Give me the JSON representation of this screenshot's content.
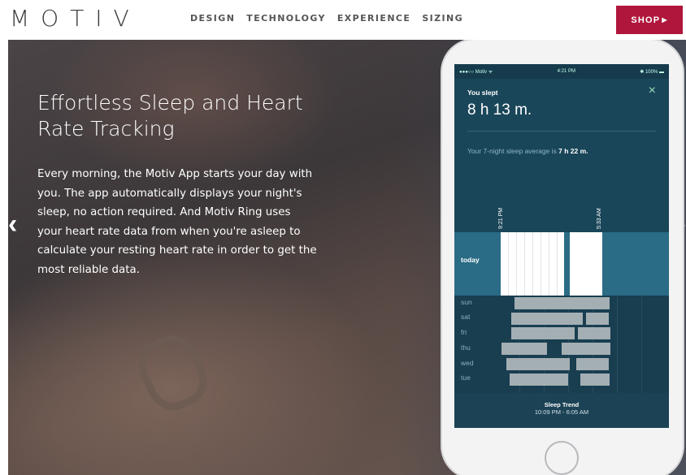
{
  "brand": {
    "logo": "MOTIV"
  },
  "nav": {
    "items": [
      {
        "label": "DESIGN"
      },
      {
        "label": "TECHNOLOGY"
      },
      {
        "label": "EXPERIENCE"
      },
      {
        "label": "SIZING"
      }
    ],
    "shop_label": "SHOP",
    "shop_arrow": "▶"
  },
  "hero": {
    "headline": "Effortless Sleep and Heart Rate Tracking",
    "body": "Every morning, the Motiv App starts your day with you. The app automatically displays your night's sleep, no action required. And Motiv Ring uses your heart rate data from when you're asleep to calculate your resting heart rate in order to get the most reliable data.",
    "prev_arrow": "‹",
    "next_arrow": "›"
  },
  "phone": {
    "status": {
      "carrier": "●●●○○ Motiv ᯤ",
      "time": "4:21 PM",
      "battery": "✱ 100% ▬"
    },
    "you_slept_label": "You slept",
    "duration": "8 h 13 m.",
    "close_icon": "×",
    "average_prefix": "Your 7-night sleep average is ",
    "average_value": "7 h 22 m.",
    "start_time": "9:21 PM",
    "end_time": "5:33 AM",
    "today_label": "today",
    "week": [
      {
        "day": "sun"
      },
      {
        "day": "sat"
      },
      {
        "day": "fri"
      },
      {
        "day": "thu"
      },
      {
        "day": "wed"
      },
      {
        "day": "tue"
      }
    ],
    "trend_title": "Sleep Trend",
    "trend_range": "10:09 PM - 6:05 AM"
  },
  "colors": {
    "shop": "#b0163b",
    "phone_bg": "#1f4a5e",
    "today_band": "#2a6b85"
  }
}
